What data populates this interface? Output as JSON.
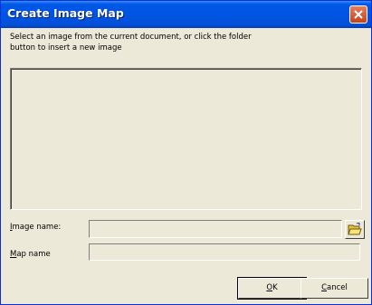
{
  "window": {
    "title": "Create Image Map"
  },
  "instruction": {
    "line1": "Select an image from the current document, or click the folder",
    "line2": "button to insert a new image"
  },
  "image_name": {
    "label_key": "I",
    "label_rest": "mage name:",
    "value": ""
  },
  "map_name": {
    "label_key": "M",
    "label_rest": "ap name",
    "value": ""
  },
  "buttons": {
    "ok_key": "O",
    "ok_rest": "K",
    "cancel_key": "C",
    "cancel_rest": "ancel"
  },
  "icons": {
    "close": "close-icon",
    "folder": "open-folder-icon"
  }
}
